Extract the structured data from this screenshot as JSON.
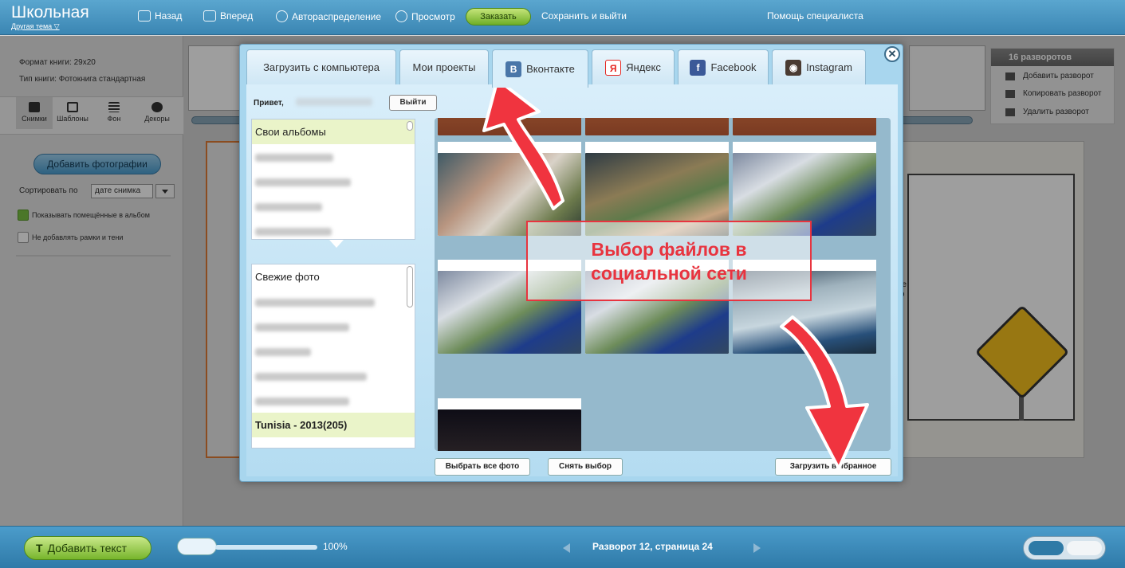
{
  "app": {
    "title": "Школьная",
    "subtitle": "Другая тема ▽"
  },
  "toolbar": {
    "back": "Назад",
    "forward": "Вперед",
    "auto": "Автораспределение",
    "preview": "Просмотр",
    "order": "Заказать",
    "save_exit": "Сохранить и выйти",
    "help": "Помощь специалиста"
  },
  "left_panel": {
    "format": "Формат книги: 29x20",
    "type": "Тип книги: Фотокнига стандартная",
    "tabs": [
      "Снимки",
      "Шаблоны",
      "Фон",
      "Декоры"
    ],
    "add_photos": "Добавить фотографии",
    "sort_label": "Сортировать по",
    "sort_value": "дате снимка",
    "show_placed": "Показывать помещённые в альбом",
    "show_placed_checked": true,
    "no_frames": "Не добавлять рамки и тени",
    "no_frames_checked": false
  },
  "right_panel": {
    "header": "16 разворотов",
    "items": [
      "Добавить разворот",
      "Копировать разворот",
      "Удалить разворот"
    ]
  },
  "page_text": "те\nю\ne",
  "modal": {
    "tabs": [
      {
        "label": "Загрузить с компьютера",
        "icon": ""
      },
      {
        "label": "Мои проекты",
        "icon": ""
      },
      {
        "label": "Вконтакте",
        "icon": "vk-icon",
        "badge": "В",
        "color": "#4a76a8"
      },
      {
        "label": "Яндекс",
        "icon": "yandex-icon",
        "badge": "Я",
        "color": "#e52620"
      },
      {
        "label": "Facebook",
        "icon": "facebook-icon",
        "badge": "f",
        "color": "#3b5998"
      },
      {
        "label": "Instagram",
        "icon": "instagram-icon",
        "badge": "◉",
        "color": "#4a3b32"
      }
    ],
    "active_tab": "Вконтакте",
    "close": "✕",
    "hello": "Привет,",
    "logout": "Выйти",
    "albums_title": "Свои альбомы",
    "photos_title": "Свежие фото",
    "highlight_album": "Tunisia - 2013(205)",
    "select_all": "Выбрать все фото",
    "deselect": "Снять выбор",
    "upload_selected": "Загрузить выбранное"
  },
  "annotation": {
    "line1": "Выбор файлов в",
    "line2": "социальной сети",
    "color": "#e8343f"
  },
  "bottom": {
    "add_text": "Добавить текст",
    "zoom": "100%",
    "spread": "Разворот 12, страница 24"
  }
}
